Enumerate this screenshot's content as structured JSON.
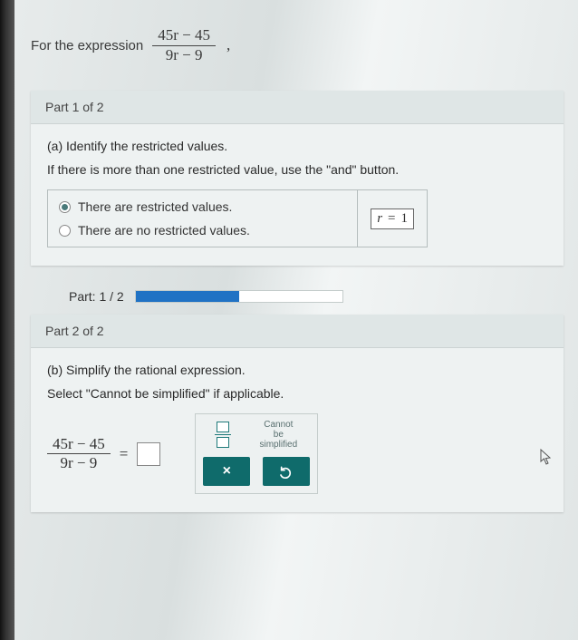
{
  "intro": {
    "prefix": "For the expression",
    "numerator": "45r − 45",
    "denominator": "9r − 9"
  },
  "part1": {
    "header": "Part 1 of 2",
    "prompt": "(a) Identify the restricted values.",
    "hint": "If there is more than one restricted value, use the \"and\" button.",
    "option_yes": "There are restricted values.",
    "option_no": "There are no restricted values.",
    "value_var": "r",
    "value_eq": "=",
    "value_num": "1"
  },
  "progress": {
    "label": "Part: 1 / 2",
    "percent": 50
  },
  "part2": {
    "header": "Part 2 of 2",
    "prompt": "(b) Simplify the rational expression.",
    "hint": "Select \"Cannot be simplified\" if applicable.",
    "numerator": "45r − 45",
    "denominator": "9r − 9",
    "eq": "=",
    "cannot_line1": "Cannot",
    "cannot_line2": "be",
    "cannot_line3": "simplified"
  }
}
